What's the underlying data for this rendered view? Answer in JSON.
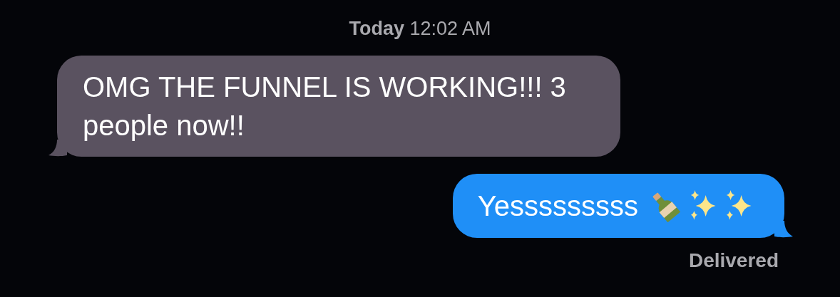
{
  "timestamp": "**Today** 12:02 AM",
  "messages": [
    {
      "kind": "incoming",
      "text": "OMG THE FUNNEL IS WORKING!!! 3 people now!!",
      "has_emoji": false
    },
    {
      "kind": "outgoing",
      "text": "Yesssssssss",
      "has_emoji": true,
      "status": "Delivered"
    }
  ]
}
